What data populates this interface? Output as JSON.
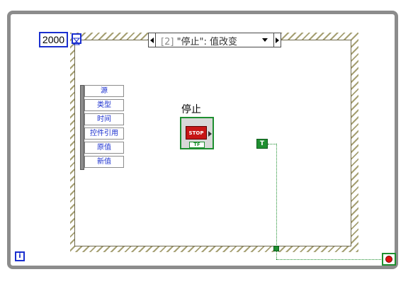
{
  "while_loop": {
    "timeout_value": "2000",
    "iteration_label": "i"
  },
  "event_selector": {
    "case_index": "[2]",
    "case_text": "\"停止\": 值改变"
  },
  "event_data_node": {
    "items": [
      "源",
      "类型",
      "时间",
      "控件引用",
      "原值",
      "新值"
    ]
  },
  "stop_terminal": {
    "label": "停止",
    "button_text": "STOP",
    "type_text": "TF"
  },
  "true_constant": {
    "text": "T"
  },
  "colors": {
    "boolean_wire": "#1e8f30",
    "integer_blue": "#1a2fcf",
    "stop_red": "#c71616"
  }
}
